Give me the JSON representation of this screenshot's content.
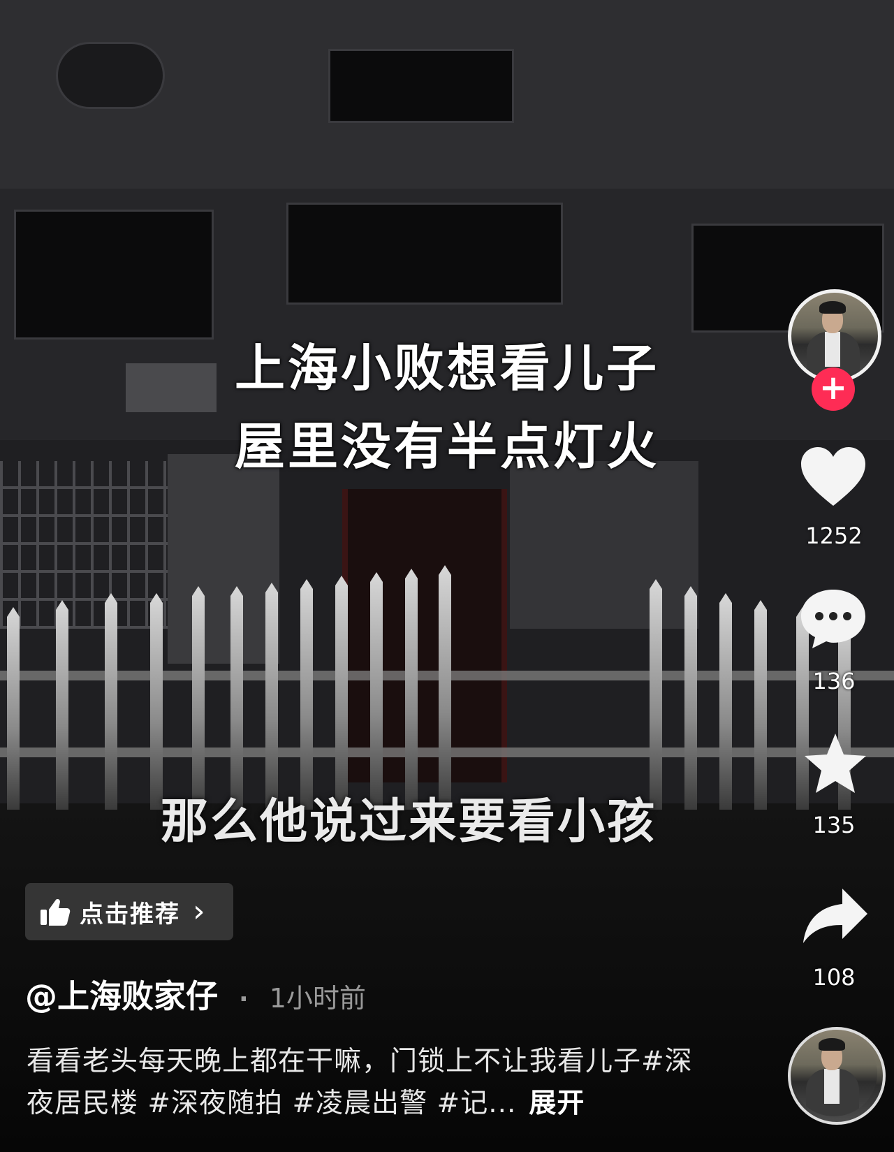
{
  "video": {
    "caption_line1": "上海小败想看儿子",
    "caption_line2": "屋里没有半点灯火",
    "subtitle": "那么他说过来要看小孩"
  },
  "actions": {
    "follow_symbol": "+",
    "like_count": "1252",
    "comment_count": "136",
    "favorite_count": "135",
    "share_count": "108"
  },
  "recommend": {
    "label": "点击推荐",
    "chevron": "›"
  },
  "post": {
    "author": "@上海败家仔",
    "separator": "·",
    "time": "1小时前",
    "description": "看看老头每天晚上都在干嘛，门锁上不让我看儿子#深夜居民楼 #深夜随拍 #凌晨出警 #记...",
    "expand_label": "展开"
  },
  "icons": [
    "heart-icon",
    "comment-icon",
    "star-icon",
    "share-icon",
    "thumbs-up-icon",
    "chevron-right-icon",
    "plus-icon"
  ],
  "colors": {
    "accent": "#fe2c55",
    "text": "#ffffff",
    "muted": "#9a9a9a"
  }
}
